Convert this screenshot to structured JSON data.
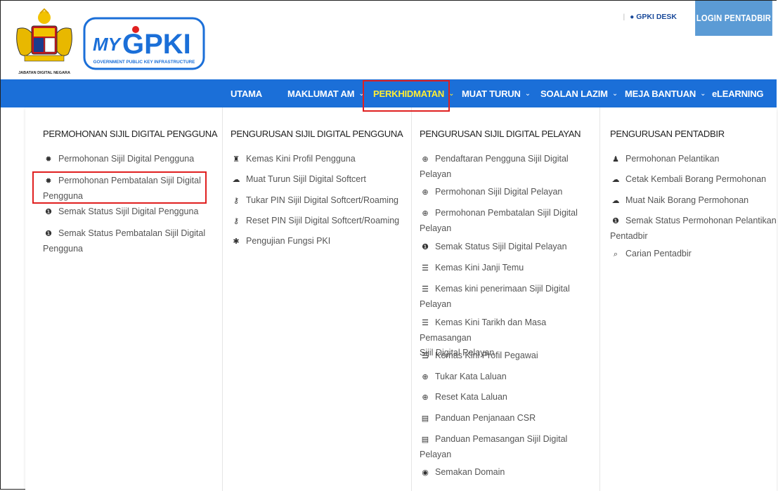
{
  "header": {
    "crest_text": "JABATAN DIGITAL NEGARA",
    "logo_main_a": "MY",
    "logo_main_b": "GPKI",
    "logo_sub": "GOVERNMENT PUBLIC KEY INFRASTRUCTURE",
    "gpki_desk": "GPKI DESK",
    "login": "LOGIN PENTADBIR"
  },
  "nav": {
    "items": [
      {
        "label": "UTAMA"
      },
      {
        "label": "MAKLUMAT AM"
      },
      {
        "label": "PERKHIDMATAN"
      },
      {
        "label": "MUAT TURUN"
      },
      {
        "label": "SOALAN LAZIM"
      },
      {
        "label": "MEJA BANTUAN"
      },
      {
        "label": "eLEARNING"
      }
    ],
    "active": "PERKHIDMATAN"
  },
  "menu": {
    "columns": [
      {
        "heading": "PERMOHONAN SIJIL DIGITAL PENGGUNA",
        "items": [
          {
            "icon": "gear-icon",
            "label": "Permohonan Sijil Digital Pengguna"
          },
          {
            "icon": "gear-icon",
            "label_l1": "Permohonan Pembatalan Sijil Digital",
            "label_l2": "Pengguna"
          },
          {
            "icon": "info-icon",
            "label": "Semak Status Sijil Digital Pengguna"
          },
          {
            "icon": "info-icon",
            "label_l1": "Semak Status Pembatalan Sijil Digital",
            "label_l2": "Pengguna"
          }
        ]
      },
      {
        "heading": "PENGURUSAN SIJIL DIGITAL PENGGUNA",
        "items": [
          {
            "icon": "user-tie-icon",
            "label": "Kemas Kini Profil Pengguna"
          },
          {
            "icon": "cloud-download-icon",
            "label": "Muat Turun Sijil Digital Softcert"
          },
          {
            "icon": "key-icon",
            "label": "Tukar PIN Sijil Digital Softcert/Roaming"
          },
          {
            "icon": "key-icon",
            "label": "Reset PIN Sijil Digital Softcert/Roaming"
          },
          {
            "icon": "asterisk-icon",
            "label": "Pengujian Fungsi PKI"
          }
        ]
      },
      {
        "heading": "PENGURUSAN SIJIL DIGITAL PELAYAN",
        "items": [
          {
            "icon": "lock-icon",
            "label_l1": "Pendaftaran Pengguna Sijil Digital",
            "label_l2": "Pelayan"
          },
          {
            "icon": "lock-icon",
            "label": "Permohonan Sijil Digital Pelayan"
          },
          {
            "icon": "lock-icon",
            "label_l1": "Permohonan Pembatalan Sijil Digital",
            "label_l2": "Pelayan"
          },
          {
            "icon": "info-icon",
            "label": "Semak Status Sijil Digital Pelayan"
          },
          {
            "icon": "list-icon",
            "label": "Kemas Kini Janji Temu"
          },
          {
            "icon": "list-icon",
            "label_l1": "Kemas kini penerimaan Sijil Digital",
            "label_l2": "Pelayan"
          },
          {
            "icon": "list-icon",
            "label_l1": "Kemas Kini Tarikh dan Masa Pemasangan",
            "label_l2": "Sijil Digital Pelayan"
          },
          {
            "icon": "list-icon",
            "label": "Kemas Kini Profil Pegawai"
          },
          {
            "icon": "lock-icon",
            "label": "Tukar Kata Laluan"
          },
          {
            "icon": "lock-icon",
            "label": "Reset Kata Laluan"
          },
          {
            "icon": "card-icon",
            "label": "Panduan Penjanaan CSR"
          },
          {
            "icon": "card-icon",
            "label_l1": "Panduan Pemasangan Sijil Digital",
            "label_l2": "Pelayan"
          },
          {
            "icon": "globe-icon",
            "label": "Semakan Domain"
          }
        ]
      },
      {
        "heading": "PENGURUSAN PENTADBIR",
        "items": [
          {
            "icon": "user-icon",
            "label": "Permohonan Pelantikan"
          },
          {
            "icon": "cloud-download-icon",
            "label": "Cetak Kembali Borang Permohonan"
          },
          {
            "icon": "cloud-upload-icon",
            "label": "Muat Naik Borang Permohonan"
          },
          {
            "icon": "info-icon",
            "label_l1": "Semak Status Permohonan Pelantikan",
            "label_l2": "Pentadbir"
          },
          {
            "icon": "search-icon",
            "label": "Carian Pentadbir"
          }
        ]
      }
    ]
  },
  "colors": {
    "nav_bg": "#1b6fd8",
    "login_bg": "#5b9bd5",
    "active_nav": "#ffee33",
    "highlight": "#e02020"
  }
}
